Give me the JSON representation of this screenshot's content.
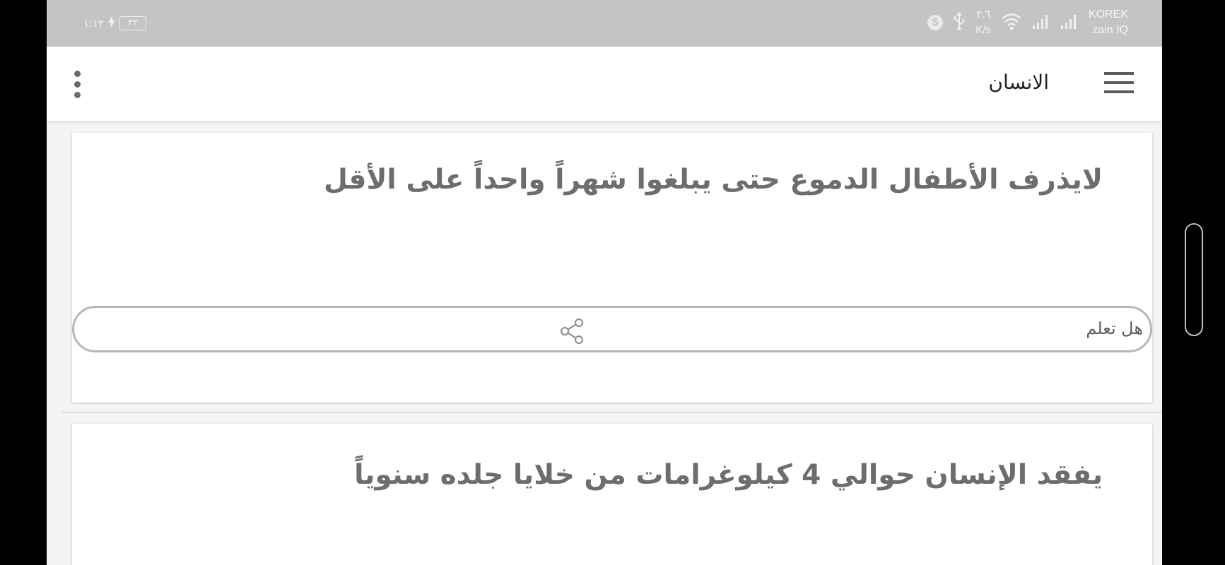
{
  "status_bar": {
    "time": "١:١٢",
    "battery": "٢٢",
    "carrier_1": "KOREK",
    "carrier_2": "zain IQ",
    "speed_value": "٢.٦",
    "speed_unit": "K/s",
    "skype_letter": "S",
    "icons": [
      "battery-icon",
      "charging-icon",
      "signal-icon",
      "signal-icon",
      "wifi-icon",
      "usb-icon",
      "skype-icon"
    ]
  },
  "app_bar": {
    "title": "الانسان",
    "menu_icon": "hamburger-menu-icon",
    "more_icon": "more-vertical-icon"
  },
  "cards": [
    {
      "text": "لايذرف الأطفال الدموع حتى يبلغوا شهراً واحداً على الأقل",
      "category_label": "هل تعلم",
      "share_icon": "share-icon"
    },
    {
      "text": "يفقد الإنسان حوالي 4 كيلوغرامات من خلايا جلده سنوياً"
    }
  ]
}
